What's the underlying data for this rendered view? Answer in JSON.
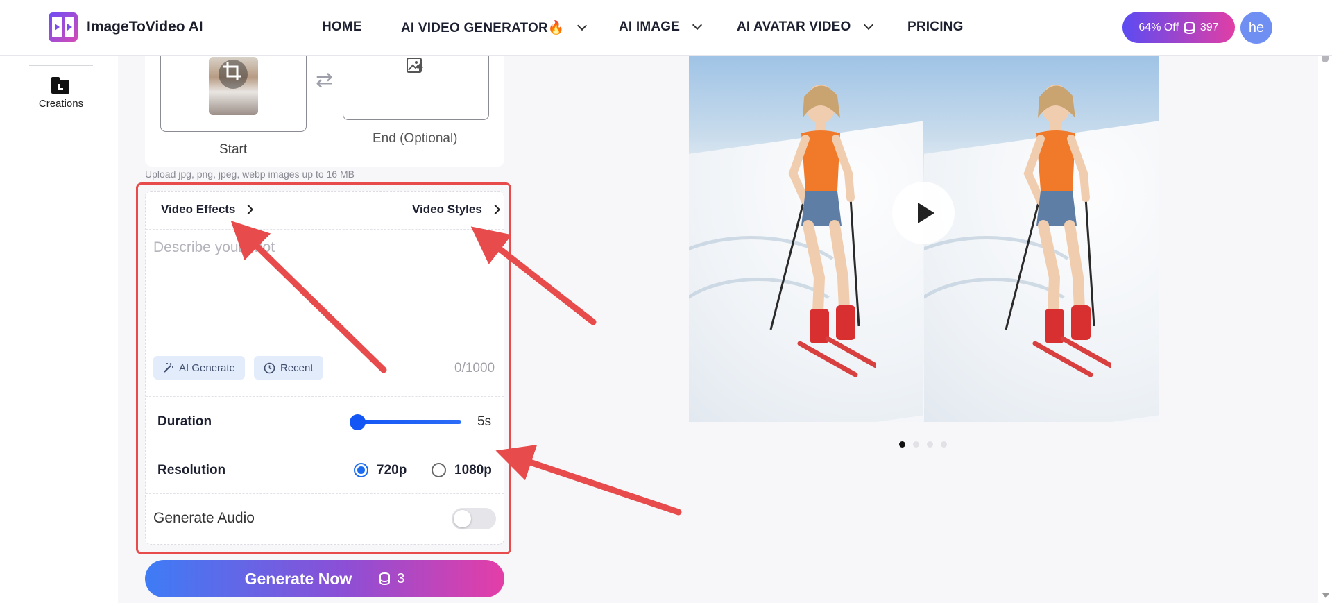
{
  "header": {
    "brand": "ImageToVideo AI",
    "nav": [
      {
        "label": "HOME",
        "dropdown": false
      },
      {
        "label": "AI VIDEO GENERATOR🔥",
        "dropdown": true
      },
      {
        "label": "AI IMAGE",
        "dropdown": true
      },
      {
        "label": "AI AVATAR VIDEO",
        "dropdown": true
      },
      {
        "label": "PRICING",
        "dropdown": false
      }
    ],
    "promo_label": "64% Off",
    "credits": "397",
    "avatar_initials": "he"
  },
  "sidebar": {
    "items": [
      {
        "label": "Creations",
        "icon": "folder-icon"
      }
    ]
  },
  "upload": {
    "start_label": "Start",
    "end_label": "End (Optional)",
    "hint": "Upload jpg, png, jpeg, webp images up to 16 MB"
  },
  "settings": {
    "tab_effects": "Video Effects",
    "tab_styles": "Video Styles",
    "prompt_placeholder": "Describe your shot",
    "prompt_value": "",
    "ai_generate_label": "AI Generate",
    "recent_label": "Recent",
    "char_counter": "0/1000",
    "duration_label": "Duration",
    "duration_value": "5s",
    "duration_fraction": 0.0,
    "resolution_label": "Resolution",
    "resolution_options": [
      "720p",
      "1080p"
    ],
    "resolution_selected": "720p",
    "audio_label": "Generate Audio",
    "audio_enabled": false
  },
  "generate": {
    "label": "Generate Now",
    "cost": "3"
  },
  "preview": {
    "slide_count": 4,
    "active_slide": 1
  },
  "colors": {
    "accent_blue": "#1456f5",
    "gradient_start": "#3e7cf6",
    "gradient_end": "#e43ea7",
    "annotation_red": "#e84b4b",
    "avatar_bg": "#6f8ff2"
  }
}
